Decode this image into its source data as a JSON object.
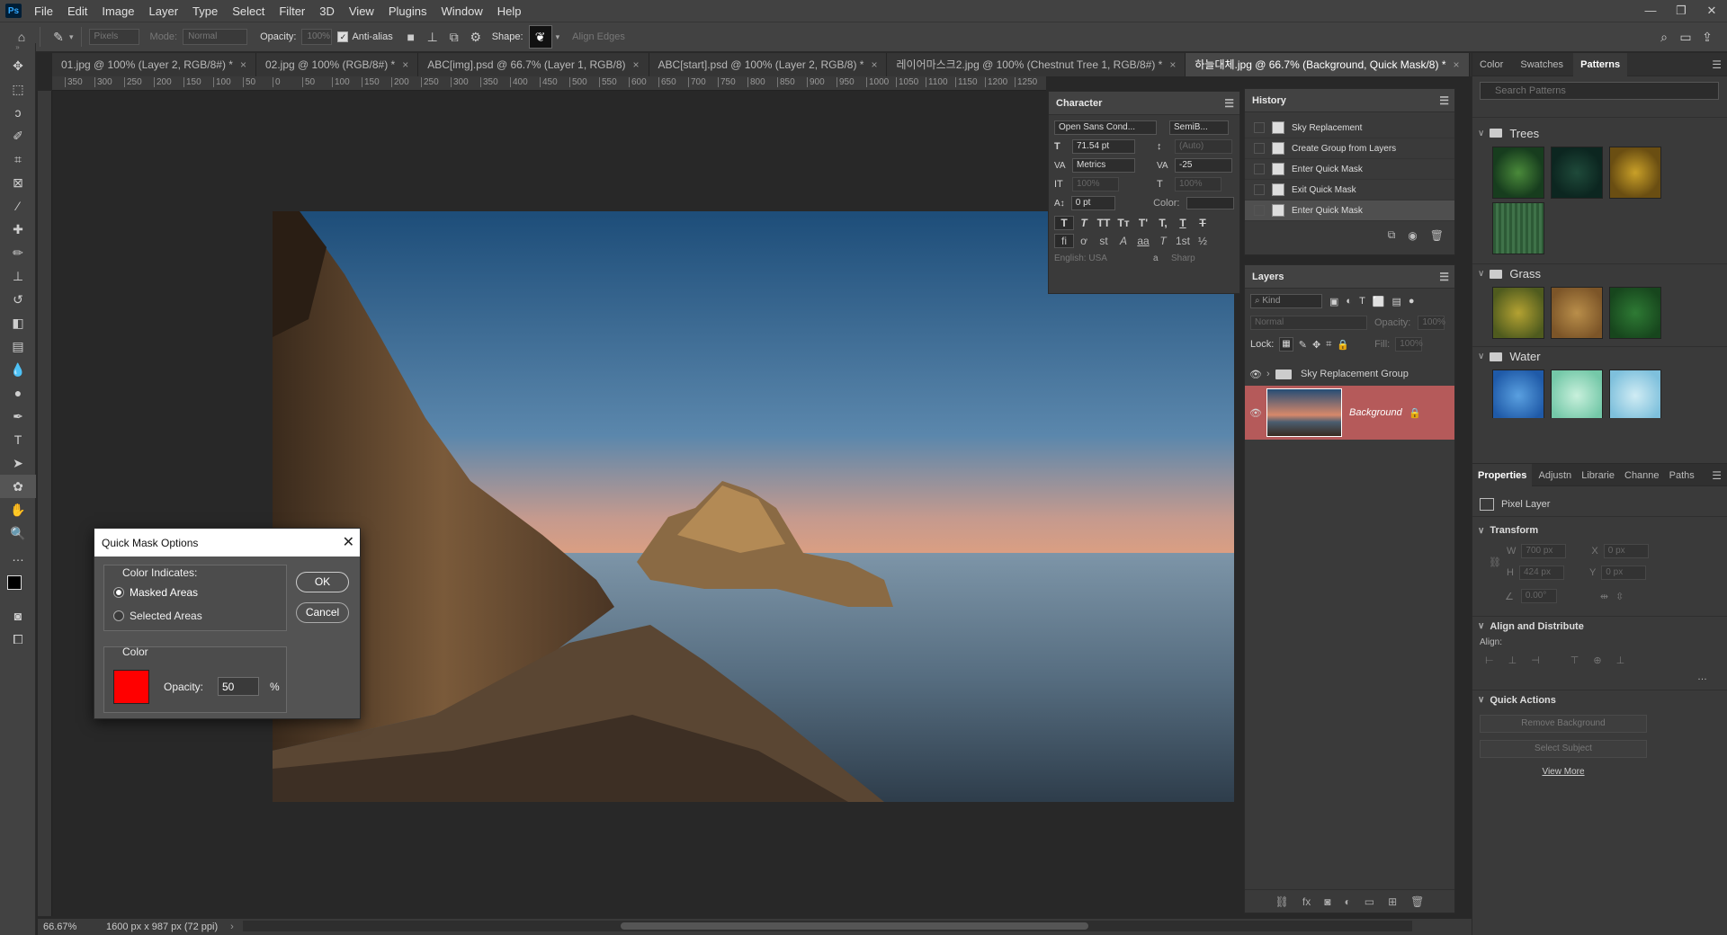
{
  "menu": {
    "items": [
      "File",
      "Edit",
      "Image",
      "Layer",
      "Type",
      "Select",
      "Filter",
      "3D",
      "View",
      "Plugins",
      "Window",
      "Help"
    ],
    "logo": "Ps"
  },
  "options": {
    "preset": "Pixels",
    "mode_label": "Mode:",
    "mode_value": "Normal",
    "opacity_label": "Opacity:",
    "opacity_value": "100%",
    "antialias": "Anti-alias",
    "shape_label": "Shape:",
    "align_edges": "Align Edges"
  },
  "tabs": [
    "01.jpg @ 100% (Layer 2, RGB/8#) *",
    "02.jpg @ 100% (RGB/8#) *",
    "ABC[img].psd @ 66.7% (Layer 1, RGB/8)",
    "ABC[start].psd @ 100% (Layer 2, RGB/8) *",
    "레이어마스크2.jpg @ 100% (Chestnut Tree 1, RGB/8#) *",
    "하늘대체.jpg @ 66.7% (Background, Quick Mask/8) *"
  ],
  "ruler": [
    "350",
    "300",
    "250",
    "200",
    "150",
    "100",
    "50",
    "0",
    "50",
    "100",
    "150",
    "200",
    "250",
    "300",
    "350",
    "400",
    "450",
    "500",
    "550",
    "600",
    "650",
    "700",
    "750",
    "800",
    "850",
    "900",
    "950",
    "1000",
    "1050",
    "1100",
    "1150",
    "1200",
    "1250"
  ],
  "status": {
    "zoom": "66.67%",
    "doc": "1600 px x 987 px (72 ppi)"
  },
  "character": {
    "title": "Character",
    "font": "Open Sans Cond...",
    "style": "SemiB...",
    "size": "71.54 pt",
    "leading": "(Auto)",
    "kerning": "Metrics",
    "tracking": "-25",
    "vscale": "100%",
    "hscale": "100%",
    "baseline": "0 pt",
    "color_label": "Color:",
    "language": "English: USA",
    "aa_icon": "a",
    "aa": "Sharp",
    "typo": [
      "T",
      "T",
      "TT",
      "Tт",
      "T'",
      "T,",
      "T",
      "T"
    ],
    "ot": [
      "fi",
      "ơ",
      "st",
      "A",
      "aa",
      "T",
      "1st",
      "½"
    ]
  },
  "history": {
    "title": "History",
    "items": [
      "Sky Replacement",
      "Create Group from Layers",
      "Enter Quick Mask",
      "Exit Quick Mask",
      "Enter Quick Mask"
    ]
  },
  "layers": {
    "title": "Layers",
    "kind": "Kind",
    "blend": "Normal",
    "opacity_label": "Opacity:",
    "opacity": "100%",
    "lock_label": "Lock:",
    "fill_label": "Fill:",
    "fill": "100%",
    "items": [
      {
        "name": "Sky Replacement Group"
      },
      {
        "name": "Background"
      }
    ]
  },
  "right": {
    "tabs": [
      "Color",
      "Swatches",
      "Patterns"
    ],
    "search_placeholder": "Search Patterns",
    "groups": [
      "Trees",
      "Grass",
      "Water"
    ]
  },
  "properties": {
    "tabs": [
      "Properties",
      "Adjustn",
      "Librarie",
      "Channe",
      "Paths"
    ],
    "pixel_layer": "Pixel Layer",
    "transform": "Transform",
    "w_label": "W",
    "w": "700 px",
    "h_label": "H",
    "h": "424 px",
    "x_label": "X",
    "x": "0 px",
    "y_label": "Y",
    "y": "0 px",
    "angle": "0.00°",
    "align_title": "Align and Distribute",
    "align_label": "Align:",
    "quick_actions": "Quick Actions",
    "remove_bg": "Remove Background",
    "select_subject": "Select Subject",
    "view_more": "View More"
  },
  "dialog": {
    "title": "Quick Mask Options",
    "close": "✕",
    "group_label": "Color Indicates:",
    "opt1": "Masked Areas",
    "opt2": "Selected Areas",
    "color_label": "Color",
    "opacity_label": "Opacity:",
    "opacity_value": "50",
    "percent": "%",
    "ok": "OK",
    "cancel": "Cancel",
    "mask_color": "#ff0000"
  }
}
